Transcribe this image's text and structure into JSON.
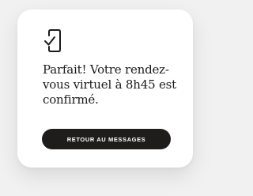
{
  "confirmation": {
    "icon": "phone-check-icon",
    "message": "Parfait! Votre rendez-vous virtuel à 8h45 est confirmé.",
    "button_label": "RETOUR AU MESSAGES"
  },
  "colors": {
    "card_bg": "#ffffff",
    "button_bg": "#1f1d1c",
    "text": "#1b1b1b"
  }
}
